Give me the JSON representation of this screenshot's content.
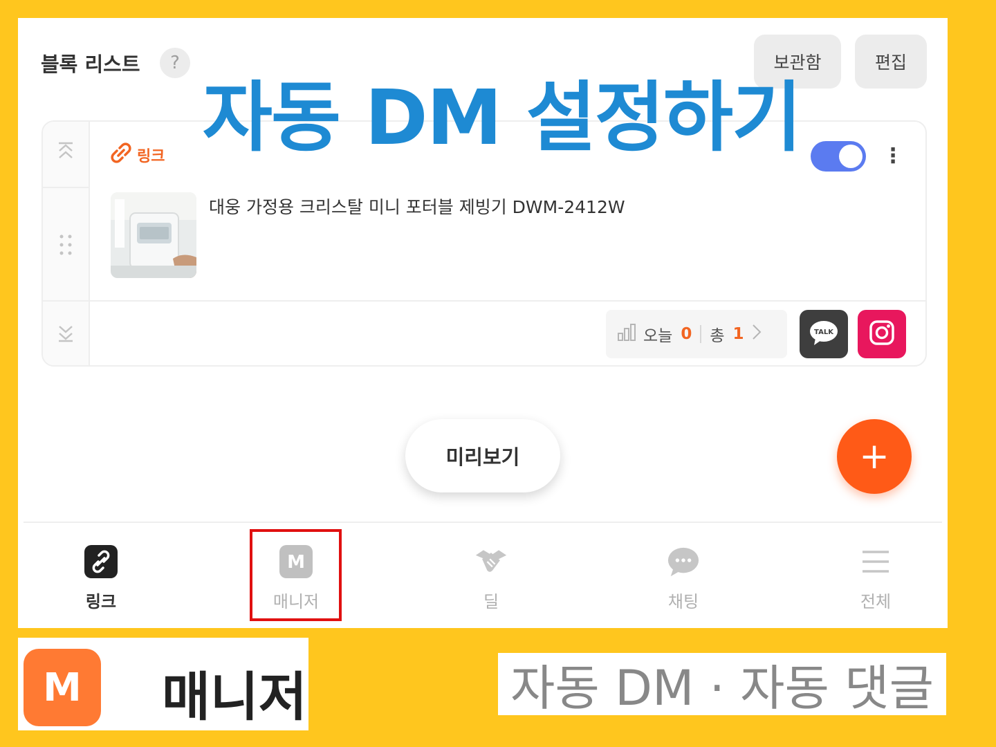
{
  "block_list": {
    "title": "블록 리스트",
    "help_icon": "?",
    "archive_button": "보관함",
    "edit_button": "편집"
  },
  "overlay_title": "자동 DM 설정하기",
  "link_block": {
    "type_label": "링크",
    "enabled": true,
    "product_title": "대웅 가정용 크리스탈 미니 포터블 제빙기 DWM-2412W",
    "stats": {
      "today_label": "오늘",
      "today_value": "0",
      "total_label": "총",
      "total_value": "1"
    },
    "share_buttons": [
      "kakaotalk-icon",
      "instagram-icon"
    ],
    "kakao_icon_text": "TALK"
  },
  "preview_button": "미리보기",
  "add_button": "+",
  "bottom_nav": {
    "items": [
      {
        "label": "링크",
        "icon": "link-icon",
        "active": true
      },
      {
        "label": "매니저",
        "icon": "manager-icon",
        "active": false,
        "icon_letter": "M"
      },
      {
        "label": "딜",
        "icon": "handshake-icon",
        "active": false
      },
      {
        "label": "채팅",
        "icon": "chat-icon",
        "active": false
      },
      {
        "label": "전체",
        "icon": "menu-icon",
        "active": false
      }
    ]
  },
  "manager_card": {
    "logo_letter": "M",
    "name": "매니저"
  },
  "feature_text": "자동 DM · 자동 댓글",
  "colors": {
    "background": "#FFC61E",
    "title_blue": "#1E8AD3",
    "accent_orange": "#F26522",
    "fab_orange": "#FF5A17",
    "toggle_blue": "#5B7BF0",
    "instagram_pink": "#E8175D",
    "highlight_red": "#E01010"
  }
}
